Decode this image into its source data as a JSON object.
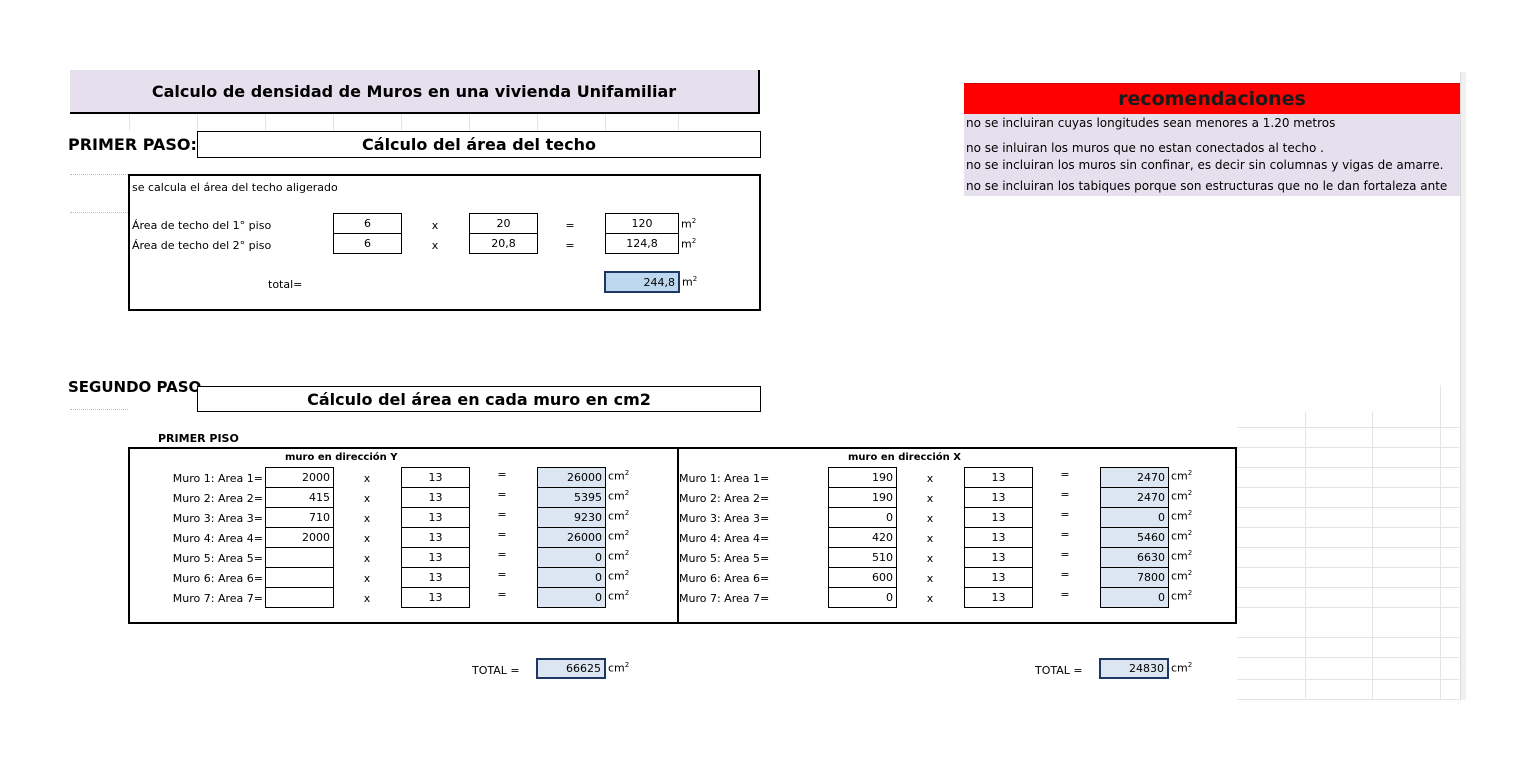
{
  "title": "Calculo de densidad de Muros en una vivienda Unifamiliar",
  "step1": {
    "label": "PRIMER PASO:",
    "heading": "Cálculo  del área del techo",
    "description": "se calcula el área del techo aligerado",
    "rows": [
      {
        "label": "Área de techo del 1° piso",
        "a": "6",
        "op": "x",
        "b": "20",
        "eq": "=",
        "result": "120",
        "unit": "m",
        "unit_sup": "2"
      },
      {
        "label": "Área de techo del 2° piso",
        "a": "6",
        "op": "x",
        "b": "20,8",
        "eq": "=",
        "result": "124,8",
        "unit": "m",
        "unit_sup": "2"
      }
    ],
    "total_label": "total=",
    "total_value": "244,8",
    "total_unit": "m",
    "total_unit_sup": "2"
  },
  "step2": {
    "label": "SEGUNDO PASO",
    "heading": "Cálculo del área en cada muro en cm2",
    "floor_label": "PRIMER PISO",
    "unit": "cm",
    "unit_sup": "2",
    "dir_y": {
      "title": "muro en dirección Y",
      "rows": [
        {
          "label": "Muro 1: Area 1=",
          "len": "2000",
          "op": "x",
          "thick": "13",
          "eq": "=",
          "area": "26000"
        },
        {
          "label": "Muro 2: Area 2=",
          "len": "415",
          "op": "x",
          "thick": "13",
          "eq": "=",
          "area": "5395"
        },
        {
          "label": "Muro 3: Area 3=",
          "len": "710",
          "op": "x",
          "thick": "13",
          "eq": "=",
          "area": "9230"
        },
        {
          "label": "Muro 4: Area 4=",
          "len": "2000",
          "op": "x",
          "thick": "13",
          "eq": "=",
          "area": "26000"
        },
        {
          "label": "Muro 5: Area 5=",
          "len": "",
          "op": "x",
          "thick": "13",
          "eq": "=",
          "area": "0"
        },
        {
          "label": "Muro 6: Area 6=",
          "len": "",
          "op": "x",
          "thick": "13",
          "eq": "=",
          "area": "0"
        },
        {
          "label": "Muro 7: Area 7=",
          "len": "",
          "op": "x",
          "thick": "13",
          "eq": "=",
          "area": "0"
        }
      ],
      "total_label": "TOTAL =",
      "total_value": "66625"
    },
    "dir_x": {
      "title": "muro en dirección X",
      "rows": [
        {
          "label": "Muro 1: Area 1=",
          "len": "190",
          "op": "x",
          "thick": "13",
          "eq": "=",
          "area": "2470"
        },
        {
          "label": "Muro 2: Area 2=",
          "len": "190",
          "op": "x",
          "thick": "13",
          "eq": "=",
          "area": "2470"
        },
        {
          "label": "Muro 3: Area 3=",
          "len": "0",
          "op": "x",
          "thick": "13",
          "eq": "=",
          "area": "0"
        },
        {
          "label": "Muro 4: Area 4=",
          "len": "420",
          "op": "x",
          "thick": "13",
          "eq": "=",
          "area": "5460"
        },
        {
          "label": "Muro 5: Area 5=",
          "len": "510",
          "op": "x",
          "thick": "13",
          "eq": "=",
          "area": "6630"
        },
        {
          "label": "Muro 6: Area 6=",
          "len": "600",
          "op": "x",
          "thick": "13",
          "eq": "=",
          "area": "7800"
        },
        {
          "label": "Muro 7: Area 7=",
          "len": "0",
          "op": "x",
          "thick": "13",
          "eq": "=",
          "area": "0"
        }
      ],
      "total_label": "TOTAL =",
      "total_value": "24830"
    }
  },
  "recommendations": {
    "title": "recomendaciones",
    "items": [
      "no se incluiran cuyas longitudes sean menores a 1.20 metros",
      "no se inluiran los muros que no estan conectados al techo .",
      "no se incluiran los muros sin confinar, es decir sin columnas y vigas de amarre.",
      "no se incluiran los tabiques porque son estructuras que no le dan fortaleza ante"
    ]
  },
  "colors": {
    "title_bg": "#e6e0ee",
    "rec_header_bg": "#ff0000",
    "result_bg": "#dce6f2",
    "total_bg": "#bdd7ee"
  }
}
